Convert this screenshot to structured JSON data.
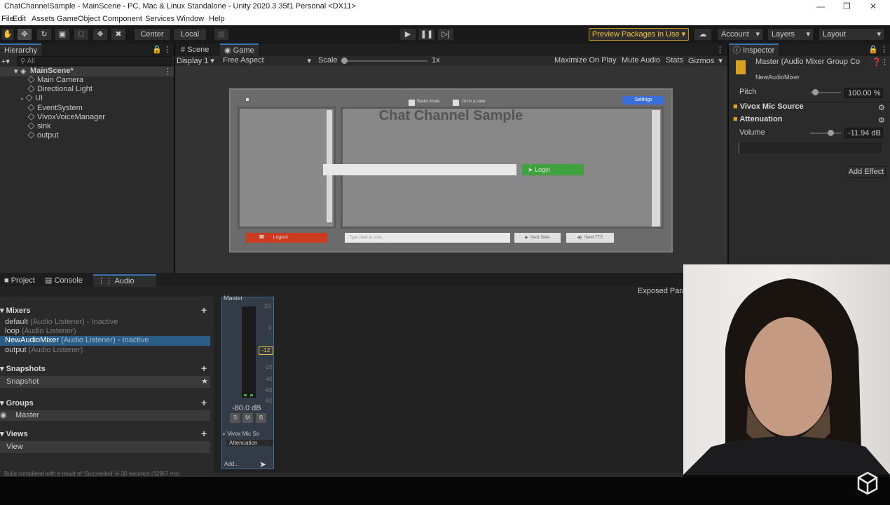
{
  "window": {
    "title": "ChatChannelSample - MainScene - PC, Mac & Linux Standalone - Unity 2020.3.35f1 Personal <DX11>"
  },
  "menu": [
    "File",
    "Edit",
    "Assets",
    "GameObject",
    "Component",
    "Services",
    "Window",
    "Help"
  ],
  "toolbar": {
    "pivot": "Center",
    "space": "Local",
    "preview_packages": "Preview Packages in Use",
    "account": "Account",
    "layers": "Layers",
    "layout": "Layout"
  },
  "hierarchy": {
    "tab": "Hierarchy",
    "search_placeholder": "All",
    "scene": "MainScene*",
    "items": [
      "Main Camera",
      "Directional Light",
      "UI",
      "EventSystem",
      "VivoxVoiceManager",
      "sink",
      "output"
    ]
  },
  "scene_tabs": {
    "scene": "Scene",
    "game": "Game"
  },
  "game_bar": {
    "display": "Display 1",
    "aspect": "Free Aspect",
    "scale_label": "Scale",
    "scale_value": "1x",
    "maximize": "Maximize On Play",
    "mute": "Mute Audio",
    "stats": "Stats",
    "gizmos": "Gizmos"
  },
  "game_ui": {
    "radio_mode": "Radio mode",
    "in_a_cave": "I'm in a cave",
    "settings": "Settings",
    "title": "Chat Channel Sample",
    "login": "Login",
    "logout": "Logout",
    "chat_placeholder": "Type here to chat",
    "next_slide": "Next Slide",
    "send_tts": "Send TTS"
  },
  "inspector": {
    "tab": "Inspector",
    "object_title": "Master (Audio Mixer Group Co",
    "object_sub": "NewAudioMixer",
    "pitch_label": "Pitch",
    "pitch_value": "100.00 %",
    "pitch_fraction": 0.1,
    "section1": "Vivox Mic Source",
    "section2": "Attenuation",
    "volume_label": "Volume",
    "volume_value": "-11.94 dB",
    "add_effect": "Add Effect"
  },
  "bottom_tabs": {
    "project": "Project",
    "console": "Console",
    "audio_mixer": "Audio Mixer"
  },
  "exposed_params": "Exposed Para",
  "mixer": {
    "mixers_header": "Mixers",
    "mixers": [
      {
        "name": "default",
        "info": "(Audio Listener) - Inactive"
      },
      {
        "name": "loop",
        "info": "(Audio Listener)"
      },
      {
        "name": "NewAudioMixer",
        "info": "(Audio Listener) - Inactive"
      },
      {
        "name": "output",
        "info": "(Audio Listener)"
      }
    ],
    "snapshots_header": "Snapshots",
    "snapshot": "Snapshot",
    "groups_header": "Groups",
    "group": "Master",
    "views_header": "Views",
    "view": "View"
  },
  "channel_strip": {
    "name": "Master",
    "scale": [
      "20",
      "0",
      "-12",
      "-20",
      "-40",
      "-60",
      "-80"
    ],
    "fader_value": "-12",
    "db": "-80.0 dB",
    "buttons": [
      "S",
      "M",
      "B"
    ],
    "effect1": "Vivox Mic So",
    "effect2": "Attenuation",
    "add": "Add..."
  },
  "status_text": "Build completed with a result of 'Succeeded' in 30 seconds (32967 ms)"
}
